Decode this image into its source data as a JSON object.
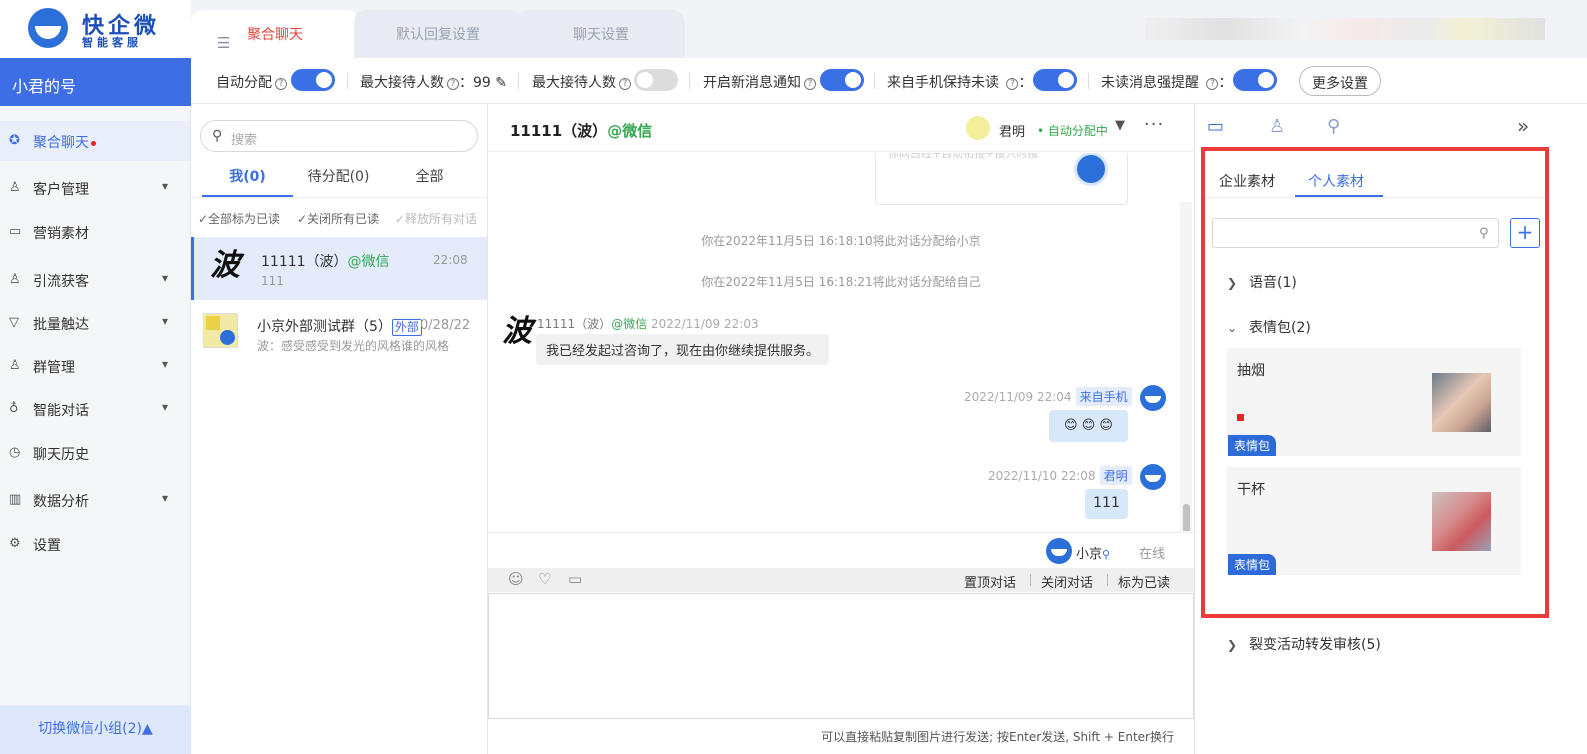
{
  "app": {
    "logo_title": "快企微",
    "logo_subtitle": "智能客服",
    "account_name": "小君的号"
  },
  "sidebar": {
    "items": [
      {
        "label": "聚合聊天",
        "icon": "wechat-icon"
      },
      {
        "label": "客户管理",
        "icon": "user-icon"
      },
      {
        "label": "营销素材",
        "icon": "folder-icon"
      },
      {
        "label": "引流获客",
        "icon": "user-plus-icon"
      },
      {
        "label": "批量触达",
        "icon": "filter-icon"
      },
      {
        "label": "群管理",
        "icon": "group-icon"
      },
      {
        "label": "智能对话",
        "icon": "bulb-icon"
      },
      {
        "label": "聊天历史",
        "icon": "clock-icon"
      },
      {
        "label": "数据分析",
        "icon": "bar-chart-icon"
      },
      {
        "label": "设置",
        "icon": "gear-icon"
      }
    ],
    "switch_group": "切换微信小组(2)▲"
  },
  "top_tabs": [
    "聚合聊天",
    "默认回复设置",
    "聊天设置"
  ],
  "settings": {
    "auto_assign": "自动分配",
    "max_reception_1": "最大接待人数",
    "max_reception_value": "：99",
    "max_reception_2": "最大接待人数",
    "new_msg_notify": "开启新消息通知",
    "phone_keep_unread": "来自手机保持未读",
    "unread_strong_remind": "未读消息强提醒",
    "colon": "：",
    "more_settings": "更多设置"
  },
  "conv_list": {
    "search_placeholder": "搜索",
    "tabs": [
      "我(0)",
      "待分配(0)",
      "全部"
    ],
    "actions": [
      "✓全部标为已读",
      "✓关闭所有已读",
      "✓释放所有对话"
    ],
    "items": [
      {
        "avatar": "波",
        "name": "11111（波）",
        "channel": "@微信",
        "time": "22:08",
        "preview": "111"
      },
      {
        "name": "小京外部测试群（5）",
        "badge": "外部",
        "time": "0/28/22",
        "preview": "波：感受感受到发光的风格谁的风格"
      }
    ]
  },
  "chat": {
    "title": "11111（波）",
    "channel": "@微信",
    "agent_name": "君明",
    "agent_status": "• 自动分配中",
    "card_text": "你同白经+自动衔接+接入时接",
    "system_msgs": [
      "你在2022年11月5日 16:18:10将此对话分配给小京",
      "你在2022年11月5日 16:18:21将此对话分配给自己"
    ],
    "incoming": {
      "sender": "11111（波）",
      "channel": "@微信",
      "time": "2022/11/09 22:03",
      "text": "我已经发起过咨询了，现在由你继续提供服务。"
    },
    "outgoing": [
      {
        "time": "2022/11/09 22:04",
        "source": "来自手机",
        "text": "😊 😊 😊"
      },
      {
        "time": "2022/11/10 22:08",
        "source": "君明",
        "text": "111"
      }
    ],
    "online_name": "小京",
    "online_status": "在线",
    "toolbar_actions": [
      "置顶对话",
      "关闭对话",
      "标为已读"
    ],
    "hint": "可以直接粘贴复制图片进行发送; 按Enter发送, Shift + Enter换行"
  },
  "materials": {
    "tabs": [
      "企业素材",
      "个人素材"
    ],
    "categories": [
      {
        "label": "语音(1)",
        "expanded": false
      },
      {
        "label": "表情包(2)",
        "expanded": true
      }
    ],
    "stickers": [
      {
        "name": "抽烟",
        "tag": "表情包"
      },
      {
        "name": "干杯",
        "tag": "表情包"
      }
    ],
    "fission": "裂变活动转发审核(5)"
  }
}
